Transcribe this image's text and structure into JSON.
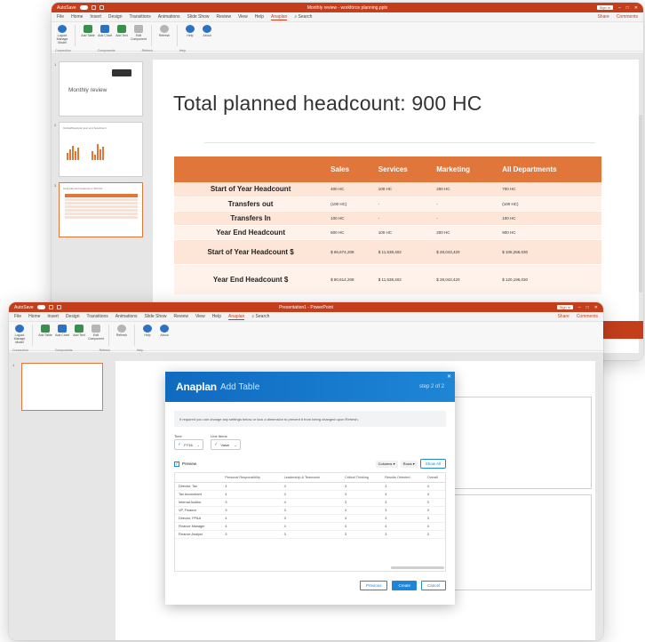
{
  "back_window": {
    "titlebar": {
      "autosave": "AutoSave",
      "title": "Monthly review - workforce planning.pptx",
      "signin": "Sign in"
    },
    "menu": [
      "File",
      "Home",
      "Insert",
      "Design",
      "Transitions",
      "Animations",
      "Slide Show",
      "Review",
      "View",
      "Help",
      "Anaplan"
    ],
    "menu_active": "Anaplan",
    "search": "Search",
    "share": "Share",
    "comments": "Comments",
    "ribbon": [
      {
        "label": "Logout Manage Model",
        "icon": "user-icon"
      },
      {
        "label": "Add Table",
        "icon": "table-icon"
      },
      {
        "label": "Add Chart",
        "icon": "chart-icon"
      },
      {
        "label": "Add Text",
        "icon": "text-icon"
      },
      {
        "label": "Edit Component",
        "icon": "edit-icon"
      },
      {
        "label": "Refresh",
        "icon": "refresh-icon"
      },
      {
        "label": "Help",
        "icon": "help-icon"
      },
      {
        "label": "About",
        "icon": "info-icon"
      }
    ],
    "ribbon_groups": [
      "Connection",
      "Components",
      "Refresh",
      "Help"
    ],
    "thumbnails": [
      {
        "num": "1",
        "title": "Monthly review"
      },
      {
        "num": "2",
        "title": "Global/Regional year end headcount"
      },
      {
        "num": "3",
        "title": "Total planned headcount: 900 HC"
      }
    ],
    "slide_title": "Total planned headcount: 900 HC",
    "table": {
      "headers": [
        "",
        "Sales",
        "Services",
        "Marketing",
        "All Departments"
      ],
      "rows": [
        {
          "label": "Start of Year Headcount",
          "values": [
            "400 HC",
            "100 HC",
            "200 HC",
            "700 HC"
          ]
        },
        {
          "label": "Transfers out",
          "values": [
            "(100 HC)",
            "-",
            "-",
            "(100 HC)"
          ]
        },
        {
          "label": "Transfers In",
          "values": [
            "100 HC",
            "-",
            "-",
            "100 HC"
          ]
        },
        {
          "label": "Year End Headcount",
          "values": [
            "600 HC",
            "100 HC",
            "200 HC",
            "900 HC"
          ]
        },
        {
          "label": "Start of Year Headcount $",
          "values": [
            "$ 66,674,208",
            "$ 11,538,402",
            "$ 28,043,420",
            "$ 106,256,030"
          ]
        },
        {
          "label": "Year End Headcount $",
          "values": [
            "$ 80,614,208",
            "$ 11,538,402",
            "$ 28,043,420",
            "$ 120,196,030"
          ]
        }
      ]
    }
  },
  "front_window": {
    "titlebar": {
      "autosave": "AutoSave",
      "title": "Presentation1 - PowerPoint",
      "signin": "Sign in"
    },
    "menu": [
      "File",
      "Home",
      "Insert",
      "Design",
      "Transitions",
      "Animations",
      "Slide Show",
      "Review",
      "View",
      "Help",
      "Anaplan"
    ],
    "menu_active": "Anaplan",
    "search": "Search",
    "share": "Share",
    "comments": "Comments",
    "ribbon": [
      {
        "label": "Logout Manage Model",
        "icon": "user-icon"
      },
      {
        "label": "Add Table",
        "icon": "table-icon"
      },
      {
        "label": "Add Chart",
        "icon": "chart-icon"
      },
      {
        "label": "Add Text",
        "icon": "text-icon"
      },
      {
        "label": "Edit Component",
        "icon": "edit-icon"
      },
      {
        "label": "Refresh",
        "icon": "refresh-icon"
      },
      {
        "label": "Help",
        "icon": "help-icon"
      },
      {
        "label": "About",
        "icon": "info-icon"
      }
    ],
    "ribbon_groups": [
      "Connection",
      "Components",
      "Refresh",
      "Help"
    ],
    "thumb_num": "1"
  },
  "dialog": {
    "logo": "Anaplan",
    "subtitle": "Add Table",
    "step": "step 2 of 2",
    "info": "If required you can change any settings below or lock a dimension to prevent it from being changed upon Refresh.",
    "time_label": "Time",
    "time_value": "FY16",
    "line_items_label": "Line Items",
    "line_items_value": "Value",
    "preview_label": "Preview",
    "columns_label": "Columns",
    "rows_label": "Rows",
    "show_all": "Show All",
    "table_headers": [
      "",
      "Personal Responsibility",
      "Leadership & Teamwork",
      "Critical Thinking",
      "Results Oriented",
      "Overall"
    ],
    "table_rows": [
      [
        "Director, Tax",
        "4",
        "4",
        "3",
        "3",
        "4"
      ],
      [
        "Tax Accountant",
        "4",
        "4",
        "3",
        "4",
        "4"
      ],
      [
        "Internal Auditor",
        "3",
        "4",
        "3",
        "3",
        "3"
      ],
      [
        "VP, Finance",
        "3",
        "3",
        "4",
        "3",
        "3"
      ],
      [
        "Director, FP&A",
        "4",
        "3",
        "3",
        "3",
        "3"
      ],
      [
        "Finance Manager",
        "4",
        "4",
        "4",
        "4",
        "4"
      ],
      [
        "Finance Analyst",
        "3",
        "3",
        "3",
        "3",
        "3"
      ]
    ],
    "btn_previous": "Previous",
    "btn_create": "Create",
    "btn_cancel": "Cancel"
  },
  "colors": {
    "accent": "#c43e1c",
    "table_orange": "#e0763a",
    "anaplan_blue": "#1e86d6"
  }
}
